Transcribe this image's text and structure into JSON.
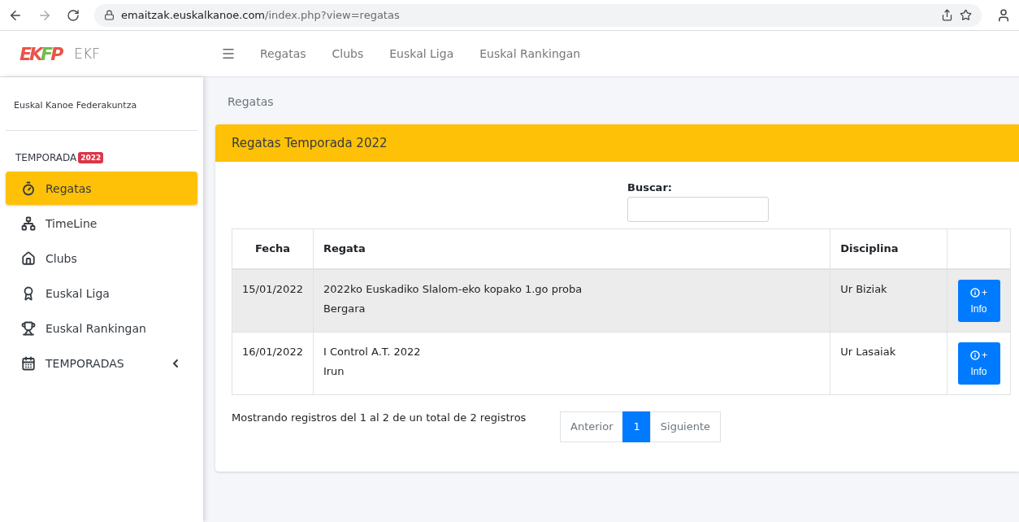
{
  "browser": {
    "url_host": "emaitzak.euskalkanoe.com",
    "url_path": "/index.php?view=regatas"
  },
  "navbar": {
    "logo_letters": [
      {
        "text": "E",
        "color": "#e8554a"
      },
      {
        "text": "K",
        "color": "#e8554a"
      },
      {
        "text": "F",
        "color": "#6cbf4a"
      },
      {
        "text": "P",
        "color": "#e8554a"
      }
    ],
    "brand": "EKF",
    "links": [
      "Regatas",
      "Clubs",
      "Euskal Liga",
      "Euskal Rankingan"
    ]
  },
  "sidebar": {
    "org": "Euskal Kanoe Federakuntza",
    "section": "TEMPORADA",
    "badge": "2022",
    "items": [
      {
        "kind": "stopwatch",
        "label": "Regatas",
        "selected": true
      },
      {
        "kind": "sitemap",
        "label": "TimeLine",
        "selected": false
      },
      {
        "kind": "house",
        "label": "Clubs",
        "selected": false
      },
      {
        "kind": "award",
        "label": "Euskal Liga",
        "selected": false
      },
      {
        "kind": "trophy",
        "label": "Euskal Rankingan",
        "selected": false
      },
      {
        "kind": "calendar",
        "label": "TEMPORADAS",
        "selected": false,
        "expanded": false
      }
    ]
  },
  "breadcrumb": "Regatas",
  "card": {
    "title": "Regatas Temporada 2022",
    "search_label": "Buscar:",
    "table": {
      "columns": [
        "Fecha",
        "Regata",
        "Disciplina"
      ],
      "rows": [
        {
          "date": "15/01/2022",
          "name": "2022ko Euskadiko Slalom-eko kopako 1.go proba",
          "place": "Bergara",
          "discipline": "Ur Biziak",
          "highlighted": true,
          "button": "+\nInfo"
        },
        {
          "date": "16/01/2022",
          "name": "I Control A.T. 2022",
          "place": "Irun",
          "discipline": "Ur Lasaiak",
          "highlighted": false,
          "button": "+\nInfo"
        }
      ]
    },
    "info": "Mostrando registros del 1 al 2 de un total de 2 registros",
    "pagination": [
      {
        "label": "Anterior",
        "selected": false
      },
      {
        "label": "1",
        "selected": true
      },
      {
        "label": "Siguiente",
        "selected": false
      }
    ]
  }
}
